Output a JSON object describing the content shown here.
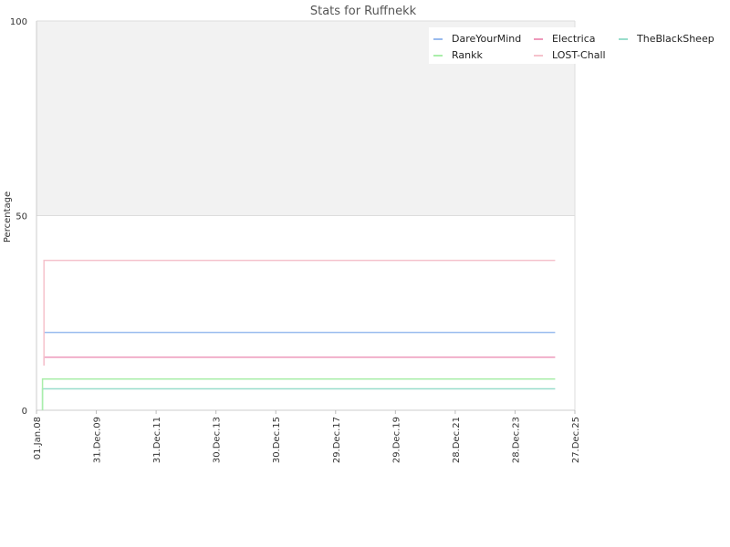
{
  "chart_data": {
    "type": "line",
    "title": "Stats for Ruffnekk",
    "xlabel": "",
    "ylabel": "Percentage",
    "ylim": [
      0,
      100
    ],
    "y_ticks": [
      0,
      50,
      100
    ],
    "x_ticks": [
      "01.Jan.08",
      "31.Dec.09",
      "31.Dec.11",
      "30.Dec.13",
      "30.Dec.15",
      "29.Dec.17",
      "29.Dec.19",
      "28.Dec.21",
      "28.Dec.23",
      "27.Dec.25"
    ],
    "xlim": [
      "2008-01-01",
      "2025-12-27"
    ],
    "grid": true,
    "legend": "top-right",
    "background_bands": [
      {
        "from": 50,
        "to": 100,
        "color": "#f2f2f2"
      },
      {
        "from": 0,
        "to": 50,
        "color": "#ffffff"
      }
    ],
    "series": [
      {
        "name": "DareYourMind",
        "color": "#99bbee",
        "points": [
          [
            "2008-04-01",
            20
          ],
          [
            "2025-05-01",
            20
          ]
        ]
      },
      {
        "name": "Electrica",
        "color": "#ee99bb",
        "points": [
          [
            "2008-04-01",
            11.5
          ],
          [
            "2008-04-15",
            13.6
          ],
          [
            "2025-05-01",
            13.6
          ]
        ]
      },
      {
        "name": "TheBlackSheep",
        "color": "#99ddcc",
        "points": [
          [
            "2008-03-15",
            0
          ],
          [
            "2008-04-01",
            5.5
          ],
          [
            "2025-05-01",
            5.5
          ]
        ]
      },
      {
        "name": "Rankk",
        "color": "#aaeeaa",
        "points": [
          [
            "2008-03-15",
            0
          ],
          [
            "2008-04-01",
            8
          ],
          [
            "2025-05-01",
            8
          ]
        ]
      },
      {
        "name": "LOST-Chall",
        "color": "#f5c2cc",
        "points": [
          [
            "2008-04-01",
            11.5
          ],
          [
            "2008-05-01",
            38.5
          ],
          [
            "2025-05-01",
            38.5
          ]
        ]
      }
    ]
  }
}
